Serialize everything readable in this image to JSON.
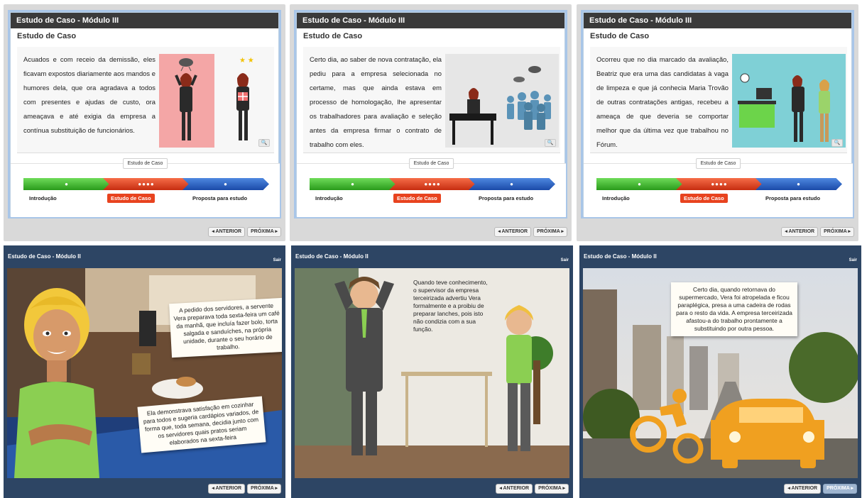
{
  "top_panels": [
    {
      "header": "Estudo de Caso - Módulo III",
      "subtitle": "Estudo de Caso",
      "text": "Acuados e com receio da demissão, eles ficavam expostos diariamente aos mandos e humores dela, que ora agradava a todos com presentes e ajudas de custo, ora ameaçava e até exigia da empresa a contínua substituição de funcionários.",
      "step_label": "Estudo de Caso",
      "steps": [
        "Introdução",
        "Estudo de Caso",
        "Proposta para estudo"
      ],
      "prev": "◂ ANTERIOR",
      "next": "PRÓXIMA ▸"
    },
    {
      "header": "Estudo de Caso - Módulo III",
      "subtitle": "Estudo de Caso",
      "text": "Certo dia, ao saber de nova contratação, ela pediu para a empresa selecionada no certame, mas que ainda estava em processo de homologação, lhe apresentar os trabalhadores para avaliação e seleção antes da empresa firmar o contrato de trabalho com eles.",
      "step_label": "Estudo de Caso",
      "steps": [
        "Introdução",
        "Estudo de Caso",
        "Proposta para estudo"
      ],
      "prev": "◂ ANTERIOR",
      "next": "PRÓXIMA ▸"
    },
    {
      "header": "Estudo de Caso - Módulo III",
      "subtitle": "Estudo de Caso",
      "text": "Ocorreu que no dia marcado da avaliação, Beatriz que era uma das candidatas à vaga de limpeza e que já conhecia Maria Trovão de outras contratações antigas, recebeu a ameaça de que deveria se comportar melhor que da última vez que trabalhou no Fórum.",
      "step_label": "Estudo de Caso",
      "steps": [
        "Introdução",
        "Estudo de Caso",
        "Proposta para estudo"
      ],
      "prev": "◂ ANTERIOR",
      "next": "PRÓXIMA ▸"
    }
  ],
  "bottom_panels": [
    {
      "header": "Estudo de Caso - Módulo II",
      "exit": "Sair",
      "bubble1": "A pedido dos servidores, a servente Vera preparava toda sexta-feira um café da manhã, que incluía fazer bolo, torta salgada e sanduíches, na própria unidade, durante o seu horário de trabalho.",
      "bubble2": "Ela demonstrava satisfação em cozinhar para todos e sugeria cardápios variados, de forma que, toda semana, decidia junto com os servidores quais pratos seriam elaborados na sexta-feira",
      "prev": "◂ ANTERIOR",
      "next": "PRÓXIMA ▸"
    },
    {
      "header": "Estudo de Caso - Módulo II",
      "exit": "Sair",
      "bubble1": "Quando teve conhecimento, o supervisor da empresa terceirizada advertiu Vera formalmente e a proibiu de preparar lanches, pois isto não condizia com a sua função.",
      "prev": "◂ ANTERIOR",
      "next": "PRÓXIMA ▸"
    },
    {
      "header": "Estudo de Caso - Módulo II",
      "exit": "Sair",
      "bubble1": "Certo dia, quando retornava do supermercado, Vera foi atropelada e ficou paraplégica, presa a uma cadeira de rodas para o resto da vida. A empresa terceirizada afastou-a do trabalho prontamente a substituindo por outra pessoa.",
      "prev": "◂ ANTERIOR",
      "next": "PRÓXIMA ▸"
    }
  ],
  "colors": {
    "green": "#2a9a1b",
    "red": "#e8431f",
    "blue": "#1a4aa8",
    "frame_blue": "#2d4564"
  }
}
